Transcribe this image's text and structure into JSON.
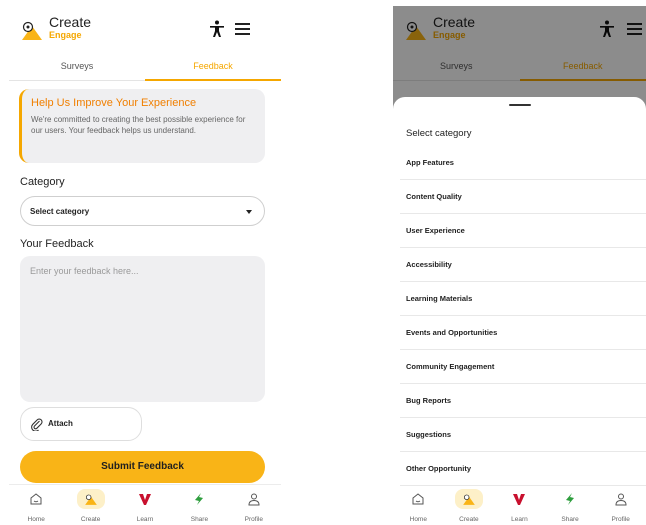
{
  "app": {
    "brand_main": "Create",
    "brand_sub": "Engage"
  },
  "tabs": [
    {
      "label": "Surveys"
    },
    {
      "label": "Feedback"
    }
  ],
  "info": {
    "title": "Help Us Improve Your Experience",
    "text": "We're committed to creating the best possible experience for our users. Your feedback helps us understand."
  },
  "form": {
    "category_label": "Category",
    "category_value": "Select category",
    "feedback_label": "Your Feedback",
    "feedback_placeholder": "Enter your feedback here...",
    "attach_label": "Attach",
    "submit_label": "Submit Feedback"
  },
  "nav": [
    {
      "label": "Home",
      "icon": "home-icon"
    },
    {
      "label": "Create",
      "icon": "create-icon"
    },
    {
      "label": "Learn",
      "icon": "learn-icon"
    },
    {
      "label": "Share",
      "icon": "share-icon"
    },
    {
      "label": "Profile",
      "icon": "profile-icon"
    }
  ],
  "sheet": {
    "title": "Select category",
    "options": [
      "App Features",
      "Content Quality",
      "User Experience",
      "Accessibility",
      "Learning Materials",
      "Events and Opportunities",
      "Community Engagement",
      "Bug Reports",
      "Suggestions",
      "Other Opportunity"
    ]
  },
  "colors": {
    "accent": "#f9b417",
    "accent_text": "#f07f00",
    "learn": "#c8102e",
    "share": "#2e9e3e"
  }
}
